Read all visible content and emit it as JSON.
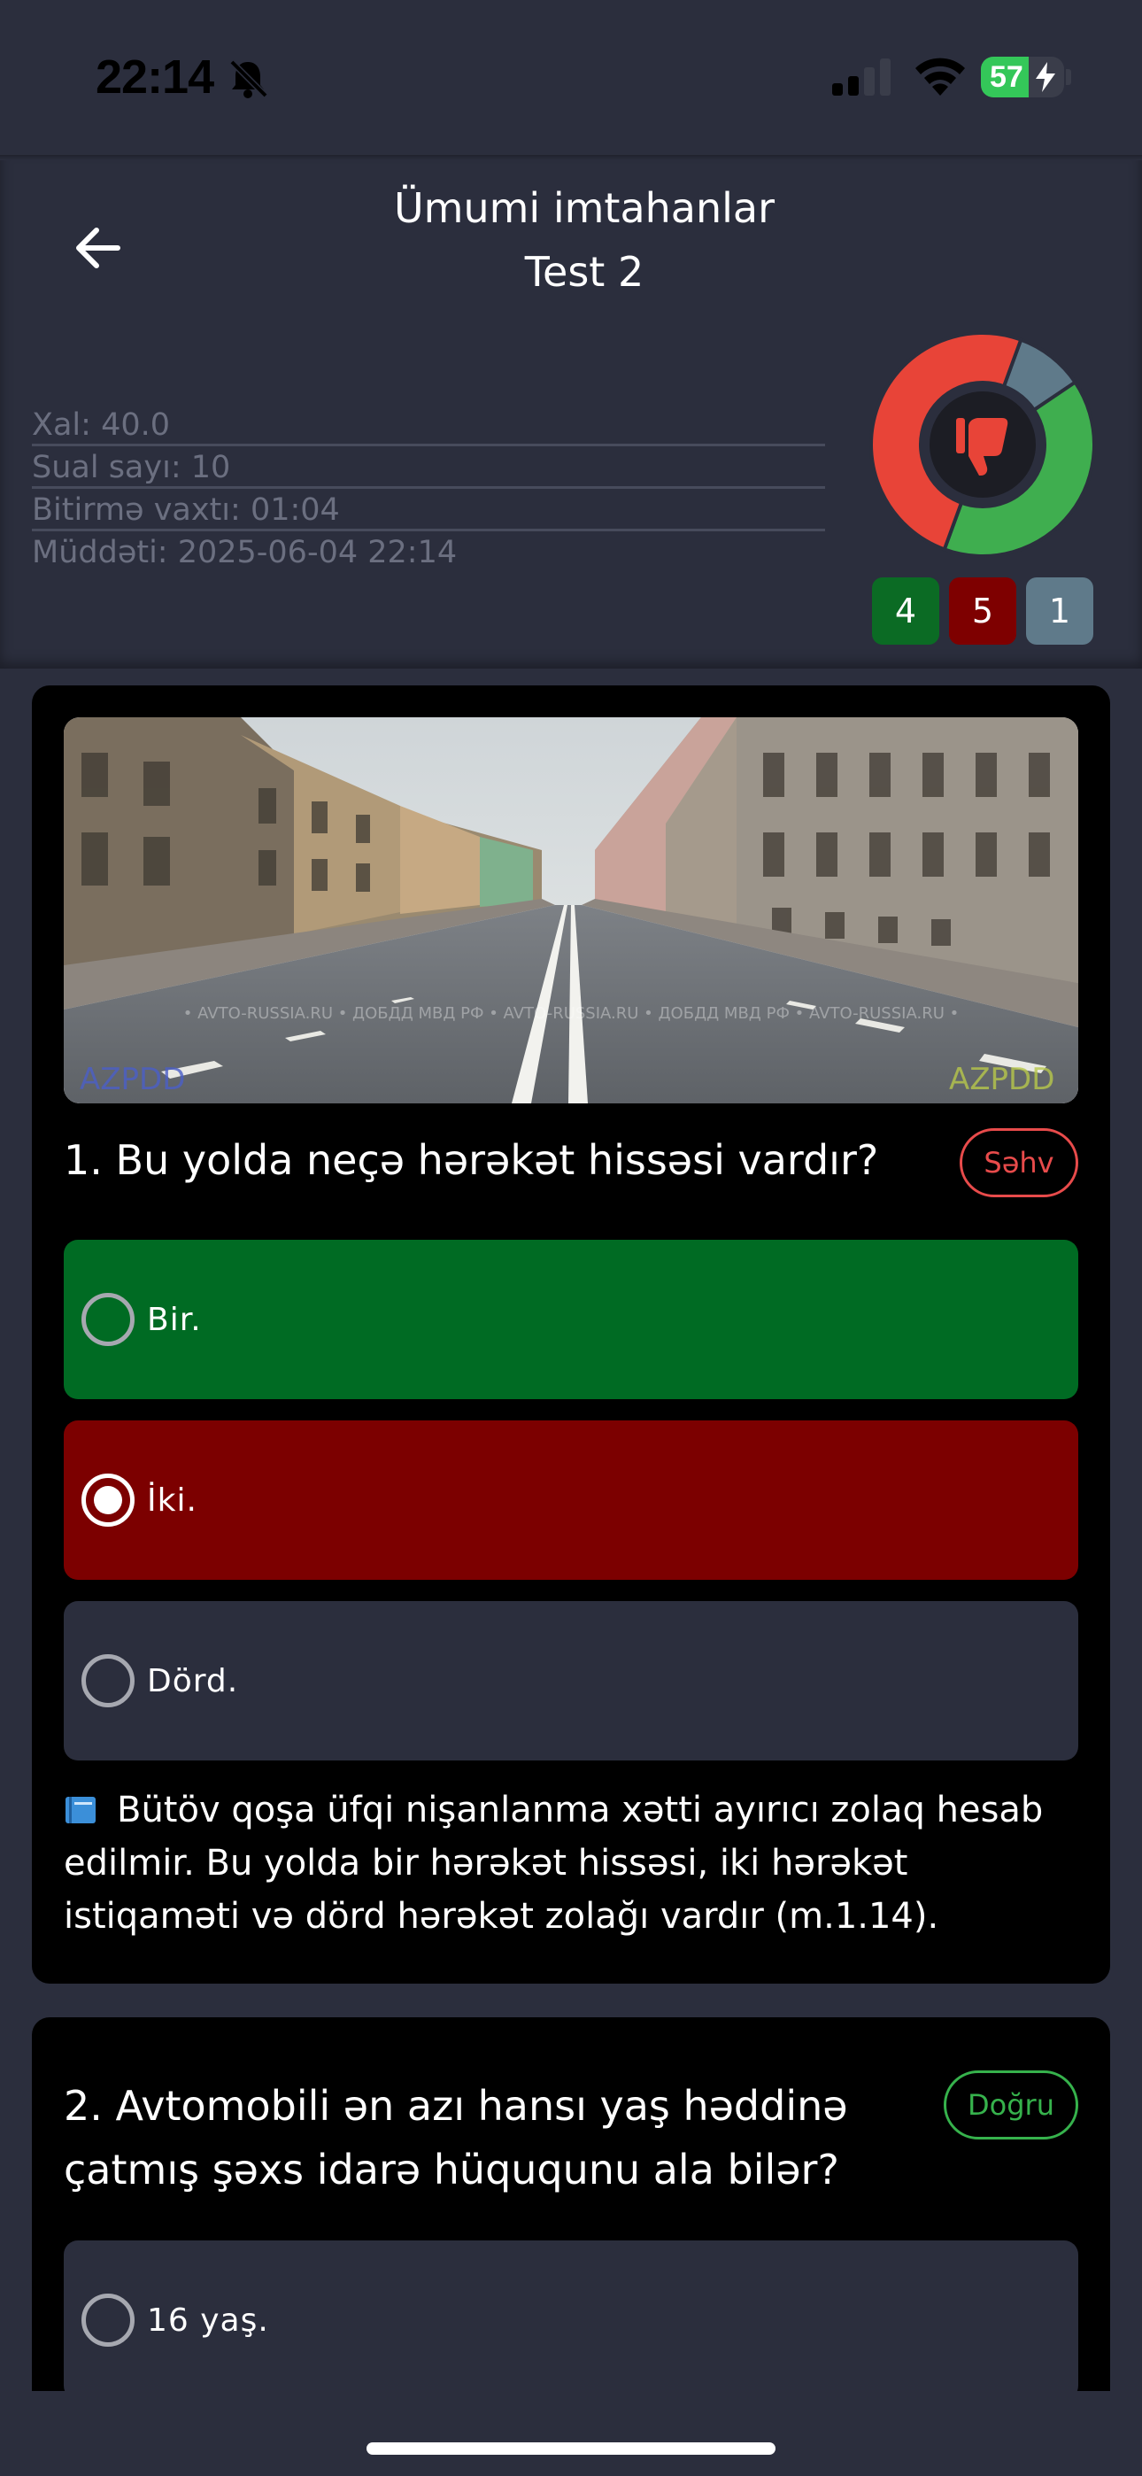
{
  "status_bar": {
    "time": "22:14",
    "battery_percent": "57",
    "battery_level": 0.57,
    "icons": [
      "bell-slash-icon",
      "signal-icon",
      "wifi-icon",
      "battery-charging-icon"
    ]
  },
  "header": {
    "title_line1": "Ümumi imtahanlar",
    "title_line2": "Test 2",
    "back_icon": "arrow-left-icon"
  },
  "stats": {
    "score": "Xal: 40.0",
    "question_count": "Sual sayı: 10",
    "finish_time": "Bitirmə vaxtı: 01:04",
    "duration": "Müddəti: 2025-06-04 22:14"
  },
  "result": {
    "icon": "thumbs-down-icon",
    "correct": "4",
    "wrong": "5",
    "unanswered": "1",
    "colors": {
      "correct": "#3fae4f",
      "wrong": "#e84438",
      "unanswered": "#5f7a8a"
    }
  },
  "questions": [
    {
      "text": "1. Bu yolda neçə hərəkət hissəsi vardır?",
      "verdict": "Səhv",
      "image_watermark_left": "AZPDD",
      "image_watermark_right": "AZPDD",
      "image_watermark_strip": "• AVTO-RUSSIA.RU • ДОБДД МВД РФ • AVTO-RUSSIA.RU • ДОБДД МВД РФ • AVTO-RUSSIA.RU •",
      "options": [
        {
          "label": "Bir.",
          "state": "correct"
        },
        {
          "label": "İki.",
          "state": "wrong-selected"
        },
        {
          "label": "Dörd.",
          "state": "neutral"
        }
      ],
      "explanation": "Bütöv qoşa üfqi nişanlanma xətti ayırıcı zolaq hesab edilmir. Bu yolda bir hərəkət hissəsi, iki hərəkət istiqaməti və dörd hərəkət zolağı vardır (m.1.14).",
      "explanation_icon": "book-icon"
    },
    {
      "text": "2. Avtomobili ən azı hansı yaş həddinə çatmış şəxs idarə hüququnu ala bilər?",
      "verdict": "Doğru",
      "options": [
        {
          "label": "16 yaş.",
          "state": "neutral"
        }
      ]
    }
  ]
}
